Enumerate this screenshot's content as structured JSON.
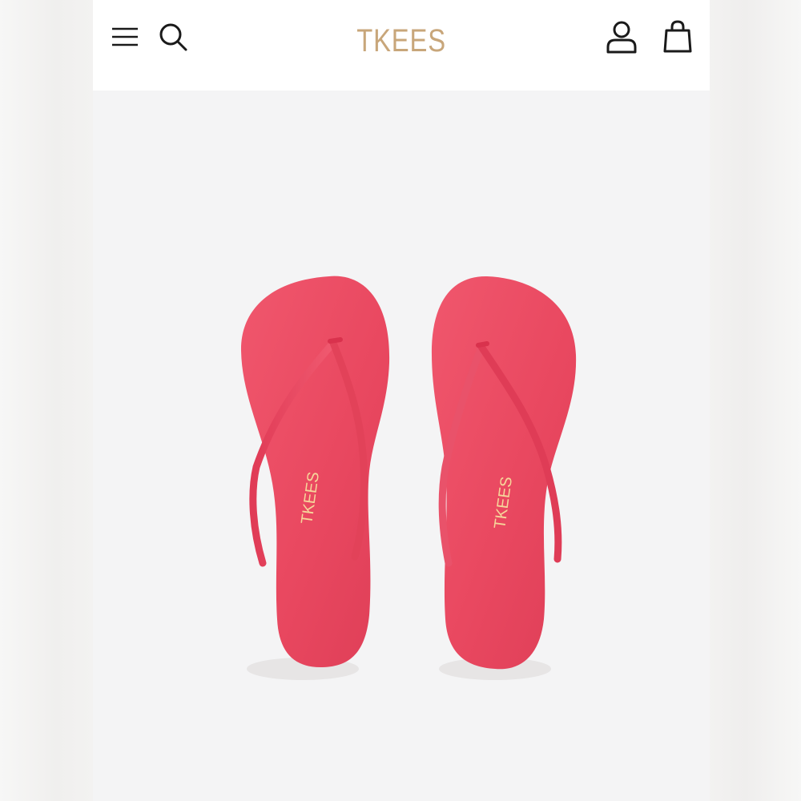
{
  "brand": {
    "logo_text": "TKEES",
    "logo_color": "#c8a67a"
  },
  "header": {
    "icons": [
      "menu-icon",
      "search-icon",
      "account-icon",
      "shopping-bag-icon"
    ]
  },
  "product": {
    "image_subject": "pair of pink leather flip-flop sandals",
    "color": "#ec4a62",
    "insole_stamp": "TKEES"
  },
  "colors": {
    "background": "#f4f4f5",
    "header": "#ffffff",
    "icon_stroke": "#1a1a1a"
  }
}
